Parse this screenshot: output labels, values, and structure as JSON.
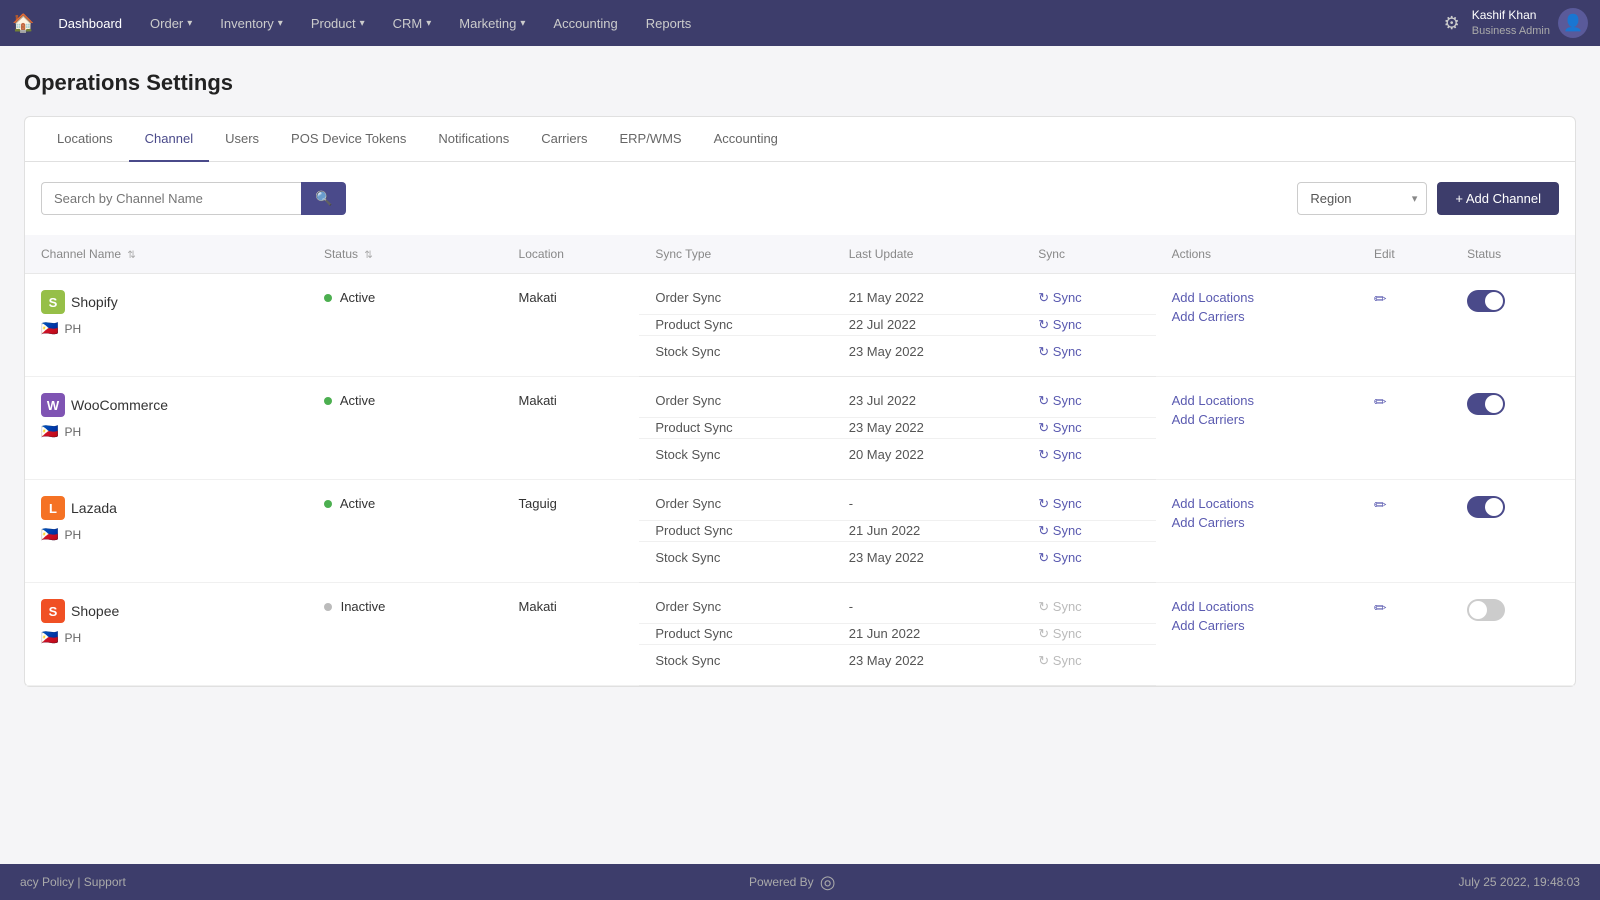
{
  "nav": {
    "home_icon": "🏠",
    "items": [
      {
        "label": "Dashboard",
        "has_dropdown": false
      },
      {
        "label": "Order",
        "has_dropdown": true
      },
      {
        "label": "Inventory",
        "has_dropdown": true
      },
      {
        "label": "Product",
        "has_dropdown": true
      },
      {
        "label": "CRM",
        "has_dropdown": true
      },
      {
        "label": "Marketing",
        "has_dropdown": true
      },
      {
        "label": "Accounting",
        "has_dropdown": false
      },
      {
        "label": "Reports",
        "has_dropdown": false
      }
    ],
    "user": {
      "name": "Kashif Khan",
      "role": "Business Admin"
    }
  },
  "page": {
    "title": "Operations Settings"
  },
  "tabs": [
    {
      "label": "Locations",
      "active": false
    },
    {
      "label": "Channel",
      "active": true
    },
    {
      "label": "Users",
      "active": false
    },
    {
      "label": "POS Device Tokens",
      "active": false
    },
    {
      "label": "Notifications",
      "active": false
    },
    {
      "label": "Carriers",
      "active": false
    },
    {
      "label": "ERP/WMS",
      "active": false
    },
    {
      "label": "Accounting",
      "active": false
    }
  ],
  "toolbar": {
    "search_placeholder": "Search by Channel Name",
    "search_icon": "🔍",
    "region_label": "Region",
    "add_channel_label": "+ Add Channel"
  },
  "table": {
    "columns": [
      {
        "label": "Channel Name",
        "sortable": true
      },
      {
        "label": "Status",
        "sortable": true
      },
      {
        "label": "Location",
        "sortable": false
      },
      {
        "label": "Sync Type",
        "sortable": false
      },
      {
        "label": "Last Update",
        "sortable": false
      },
      {
        "label": "Sync",
        "sortable": false
      },
      {
        "label": "Actions",
        "sortable": false
      },
      {
        "label": "Edit",
        "sortable": false
      },
      {
        "label": "Status",
        "sortable": false
      }
    ],
    "rows": [
      {
        "id": "shopify",
        "icon_type": "shopify",
        "icon_label": "S",
        "name": "Shopify",
        "flag": "🇵🇭",
        "country": "PH",
        "status": "Active",
        "status_type": "active",
        "location": "Makati",
        "sync_rows": [
          {
            "type": "Order Sync",
            "last_update": "21 May 2022",
            "sync_disabled": false
          },
          {
            "type": "Product Sync",
            "last_update": "22 Jul 2022",
            "sync_disabled": false
          },
          {
            "type": "Stock Sync",
            "last_update": "23 May 2022",
            "sync_disabled": false
          }
        ],
        "actions": [
          "Add Locations",
          "Add Carriers"
        ],
        "toggle_on": true
      },
      {
        "id": "woocommerce",
        "icon_type": "woo",
        "icon_label": "W",
        "name": "WooCommerce",
        "flag": "🇵🇭",
        "country": "PH",
        "status": "Active",
        "status_type": "active",
        "location": "Makati",
        "sync_rows": [
          {
            "type": "Order Sync",
            "last_update": "23 Jul 2022",
            "sync_disabled": false
          },
          {
            "type": "Product Sync",
            "last_update": "23 May 2022",
            "sync_disabled": false
          },
          {
            "type": "Stock Sync",
            "last_update": "20 May 2022",
            "sync_disabled": false
          }
        ],
        "actions": [
          "Add Locations",
          "Add Carriers"
        ],
        "toggle_on": true
      },
      {
        "id": "lazada",
        "icon_type": "lazada",
        "icon_label": "L",
        "name": "Lazada",
        "flag": "🇵🇭",
        "country": "PH",
        "status": "Active",
        "status_type": "active",
        "location": "Taguig",
        "sync_rows": [
          {
            "type": "Order Sync",
            "last_update": "-",
            "sync_disabled": false
          },
          {
            "type": "Product Sync",
            "last_update": "21 Jun 2022",
            "sync_disabled": false
          },
          {
            "type": "Stock Sync",
            "last_update": "23 May 2022",
            "sync_disabled": false
          }
        ],
        "actions": [
          "Add Locations",
          "Add Carriers"
        ],
        "toggle_on": true
      },
      {
        "id": "shopee",
        "icon_type": "shopee",
        "icon_label": "S",
        "name": "Shopee",
        "flag": "🇵🇭",
        "country": "PH",
        "status": "Inactive",
        "status_type": "inactive",
        "location": "Makati",
        "sync_rows": [
          {
            "type": "Order Sync",
            "last_update": "-",
            "sync_disabled": true
          },
          {
            "type": "Product Sync",
            "last_update": "21 Jun 2022",
            "sync_disabled": true
          },
          {
            "type": "Stock Sync",
            "last_update": "23 May 2022",
            "sync_disabled": true
          }
        ],
        "actions": [
          "Add Locations",
          "Add Carriers"
        ],
        "toggle_on": false
      }
    ]
  },
  "footer": {
    "left": "acy Policy | Support",
    "powered_by": "Powered By",
    "right": "July 25 2022, 19:48:03"
  }
}
